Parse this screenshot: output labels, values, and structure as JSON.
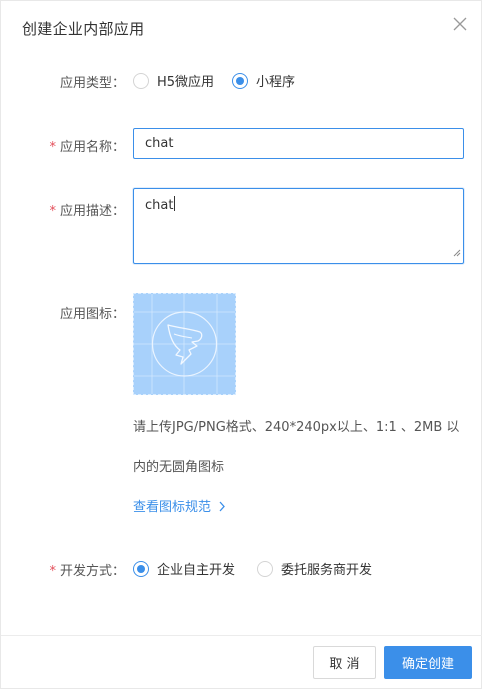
{
  "dialog": {
    "title": "创建企业内部应用",
    "close_icon": "close-icon"
  },
  "form": {
    "app_type": {
      "label": "应用类型：",
      "options": [
        {
          "label": "H5微应用",
          "selected": false
        },
        {
          "label": "小程序",
          "selected": true
        }
      ]
    },
    "app_name": {
      "required_mark": "*",
      "label": "应用名称：",
      "value": "chat"
    },
    "app_desc": {
      "required_mark": "*",
      "label": "应用描述：",
      "value": "chat"
    },
    "app_icon": {
      "label": "应用图标：",
      "hint_line1": "请上传JPG/PNG格式、240*240px以上、1:1 、2MB 以",
      "hint_line2": "内的无圆角图标",
      "spec_link": "查看图标规范",
      "spec_link_icon": "chevron-right-icon",
      "placeholder_icon": "dingtalk-logo-icon"
    },
    "dev_mode": {
      "required_mark": "*",
      "label": "开发方式：",
      "options": [
        {
          "label": "企业自主开发",
          "selected": true
        },
        {
          "label": "委托服务商开发",
          "selected": false
        }
      ]
    }
  },
  "footer": {
    "cancel_label": "取 消",
    "confirm_label": "确定创建"
  },
  "colors": {
    "accent": "#3b8fe9",
    "required": "#e34d59",
    "icon_placeholder_bg": "#a8d1fb"
  }
}
